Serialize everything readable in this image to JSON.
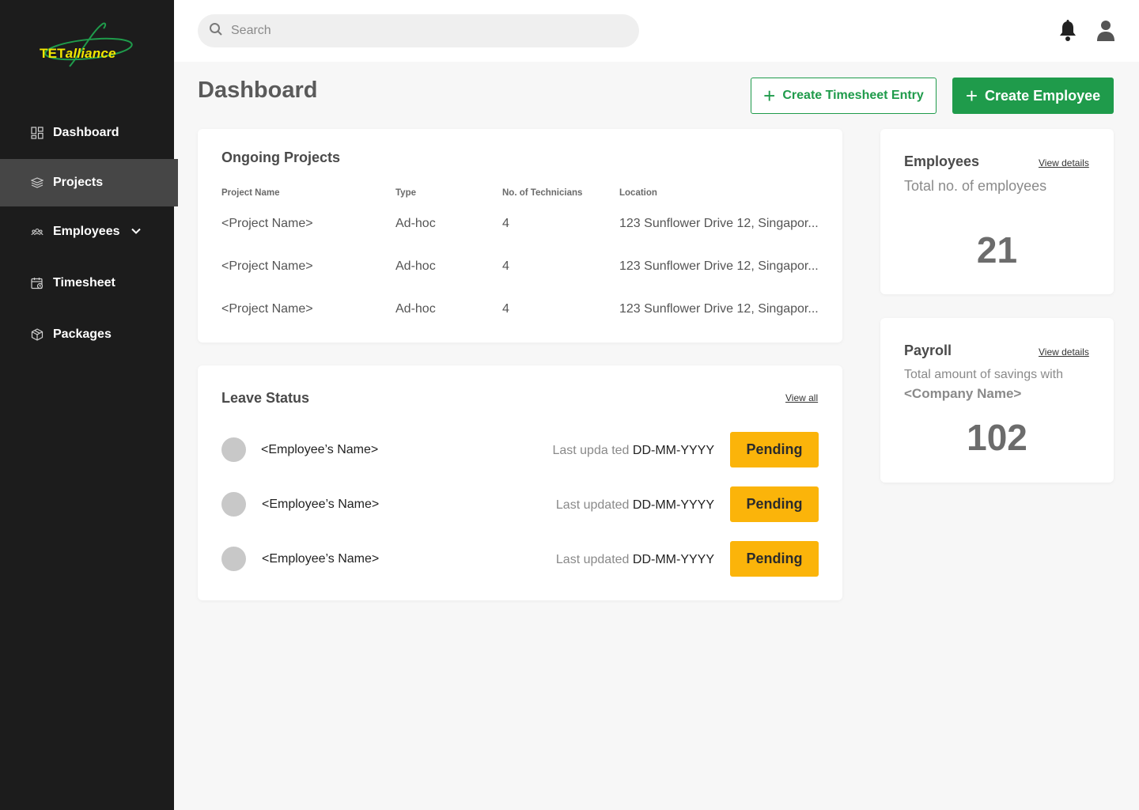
{
  "brand": {
    "logo_part1": "TET",
    "logo_part2": "alliance",
    "logo_color": "#f2e600",
    "logo_swoosh_color": "#1f9b4b"
  },
  "sidebar": {
    "items": [
      {
        "label": "Dashboard",
        "icon": "dashboard-grid-icon",
        "active": false
      },
      {
        "label": "Projects",
        "icon": "layers-icon",
        "active": true
      },
      {
        "label": "Employees",
        "icon": "group-icon",
        "active": false,
        "expandable": true
      },
      {
        "label": "Timesheet",
        "icon": "calendar-clock-icon",
        "active": false
      },
      {
        "label": "Packages",
        "icon": "package-box-icon",
        "active": false
      }
    ]
  },
  "topbar": {
    "search_placeholder": "Search",
    "notifications_icon": "bell-icon",
    "profile_icon": "user-icon"
  },
  "header": {
    "title": "Dashboard",
    "create_timesheet_label": "Create Timesheet Entry",
    "create_employee_label": "Create Employee"
  },
  "projects": {
    "title": "Ongoing Projects",
    "columns": [
      "Project Name",
      "Type",
      "No. of Technicians",
      "Location"
    ],
    "rows": [
      {
        "name": "<Project Name>",
        "type": "Ad-hoc",
        "technicians": "4",
        "location": "123 Sunflower Drive 12, Singapor..."
      },
      {
        "name": "<Project Name>",
        "type": "Ad-hoc",
        "technicians": "4",
        "location": "123 Sunflower Drive 12, Singapor..."
      },
      {
        "name": "<Project Name>",
        "type": "Ad-hoc",
        "technicians": "4",
        "location": "123 Sunflower Drive 12, Singapor..."
      }
    ]
  },
  "leave": {
    "title": "Leave Status",
    "view_all": "View all",
    "rows": [
      {
        "name": "<Employee’s Name>",
        "updated_label": "Last upda ted",
        "date": "DD-MM-YYYY",
        "status": "Pending"
      },
      {
        "name": "<Employee’s Name>",
        "updated_label": "Last updated",
        "date": "DD-MM-YYYY",
        "status": "Pending"
      },
      {
        "name": "<Employee’s Name>",
        "updated_label": "Last updated",
        "date": "DD-MM-YYYY",
        "status": "Pending"
      }
    ]
  },
  "employees_card": {
    "title": "Employees",
    "link": "View details",
    "subtitle": "Total no. of employees",
    "value": "21"
  },
  "payroll_card": {
    "title": "Payroll",
    "link": "View details",
    "subtitle": "Total amount of savings with",
    "company": "<Company Name>",
    "value": "102"
  },
  "colors": {
    "sidebar_bg": "#1c1c1c",
    "sidebar_active": "#464646",
    "accent_green": "#1f9b4b",
    "pending_yellow": "#fbb40a"
  }
}
